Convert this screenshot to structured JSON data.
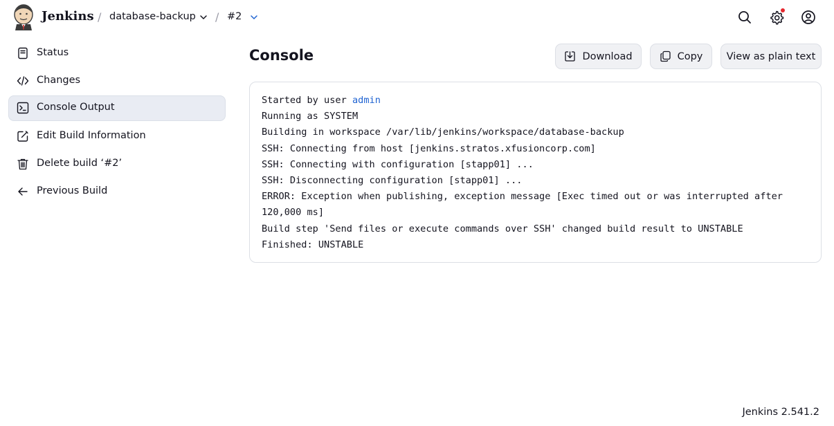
{
  "header": {
    "brand": "Jenkins",
    "breadcrumb": [
      {
        "label": "database-backup"
      },
      {
        "label": "#2"
      }
    ],
    "separator": "/",
    "icons": [
      "search-icon",
      "gear-icon",
      "user-icon"
    ],
    "notification_color": "#e5272e"
  },
  "sidebar": {
    "items": [
      {
        "label": "Status",
        "icon": "document-icon",
        "active": false
      },
      {
        "label": "Changes",
        "icon": "code-icon",
        "active": false
      },
      {
        "label": "Console Output",
        "icon": "terminal-icon",
        "active": true
      },
      {
        "label": "Edit Build Information",
        "icon": "edit-icon",
        "active": false
      },
      {
        "label": "Delete build ‘#2’",
        "icon": "trash-icon",
        "active": false
      },
      {
        "label": "Previous Build",
        "icon": "arrow-left-icon",
        "active": false
      }
    ]
  },
  "main": {
    "title": "Console",
    "buttons": {
      "download": "Download",
      "copy": "Copy",
      "plain": "View as plain text"
    },
    "console": {
      "started_prefix": "Started by user ",
      "started_user": "admin",
      "lines": [
        "Running as SYSTEM",
        "Building in workspace /var/lib/jenkins/workspace/database-backup",
        "SSH: Connecting from host [jenkins.stratos.xfusioncorp.com]",
        "SSH: Connecting with configuration [stapp01] ...",
        "SSH: Disconnecting configuration [stapp01] ...",
        "ERROR: Exception when publishing, exception message [Exec timed out or was interrupted after",
        "120,000 ms]",
        "Build step 'Send files or execute commands over SSH' changed build result to UNSTABLE",
        "Finished: UNSTABLE"
      ]
    }
  },
  "footer": {
    "version": "Jenkins 2.541.2"
  },
  "colors": {
    "link": "#2064d2",
    "active_bg": "#e9ecf3",
    "button_bg": "#f0f1f4"
  }
}
